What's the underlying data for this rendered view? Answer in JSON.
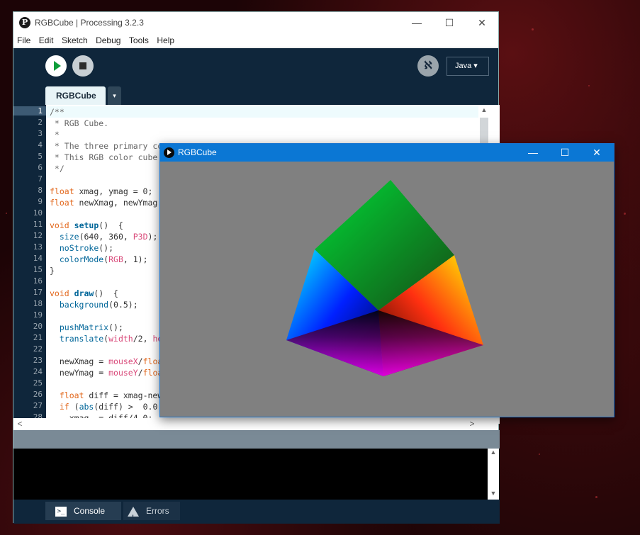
{
  "ide": {
    "title": "RGBCube | Processing 3.2.3",
    "logo_glyph": "P",
    "window_controls": {
      "minimize": "—",
      "maximize": "☐",
      "close": "✕"
    },
    "menu": [
      "File",
      "Edit",
      "Sketch",
      "Debug",
      "Tools",
      "Help"
    ],
    "debug_glyph": "ℵ",
    "mode": "Java ▾",
    "tab": "RGBCube",
    "tab_menu": "▾",
    "line_numbers": [
      "1",
      "2",
      "3",
      "4",
      "5",
      "6",
      "7",
      "8",
      "9",
      "10",
      "11",
      "12",
      "13",
      "14",
      "15",
      "16",
      "17",
      "18",
      "19",
      "20",
      "21",
      "22",
      "23",
      "24",
      "25",
      "26",
      "27",
      "28"
    ],
    "code": {
      "l1": "/**",
      "l2": " * RGB Cube.",
      "l3": " *",
      "l4": " * The three primary co",
      "l5": " * This RGB color cube",
      "l6": " */",
      "l8_kw": "float",
      "l8_rest": " xmag, ymag = 0;",
      "l9_kw": "float",
      "l9_rest": " newXmag, newYmag",
      "l11_kw": "void",
      "l11_fn": "setup",
      "l11_rest": "()  {",
      "l12_fn": "size",
      "l12_a": "(640, 360, ",
      "l12_const": "P3D",
      "l12_b": ");",
      "l13_fn": "noStroke",
      "l13_rest": "();",
      "l14_fn": "colorMode",
      "l14_a": "(",
      "l14_const": "RGB",
      "l14_b": ", 1);",
      "l15": "}",
      "l17_kw": "void",
      "l17_fn": "draw",
      "l17_rest": "()  {",
      "l18_fn": "background",
      "l18_rest": "(0.5);",
      "l20_fn": "pushMatrix",
      "l20_rest": "();",
      "l21_fn": "translate",
      "l21_a": "(",
      "l21_v1": "width",
      "l21_b": "/2, ",
      "l21_v2": "he",
      "l23_a": "newXmag = ",
      "l23_v": "mouseX",
      "l23_b": "/",
      "l23_kw": "floa",
      "l24_a": "newYmag = ",
      "l24_v": "mouseY",
      "l24_b": "/",
      "l24_kw": "floa",
      "l26_kw": "float",
      "l26_rest": " diff = xmag-new",
      "l27_kw": "if",
      "l27_a": " (",
      "l27_fn": "abs",
      "l27_b": "(diff) >  0.0",
      "l28": "    xmag -= diff/4.0;"
    },
    "bottom_tabs": {
      "console": "Console",
      "errors": "Errors",
      "console_glyph": ">_"
    },
    "scroll_arrows": {
      "up": "▲",
      "down": "▼",
      "left": "<",
      "right": ">"
    }
  },
  "sketch": {
    "title": "RGBCube",
    "window_controls": {
      "minimize": "—",
      "maximize": "☐",
      "close": "✕"
    }
  },
  "colors": {
    "ide_dark": "#0f263b",
    "sketch_bg": "#808080",
    "sketch_title": "#0b77d4",
    "keyword": "#e2661a",
    "function": "#006699",
    "constant": "#d94a7a"
  }
}
